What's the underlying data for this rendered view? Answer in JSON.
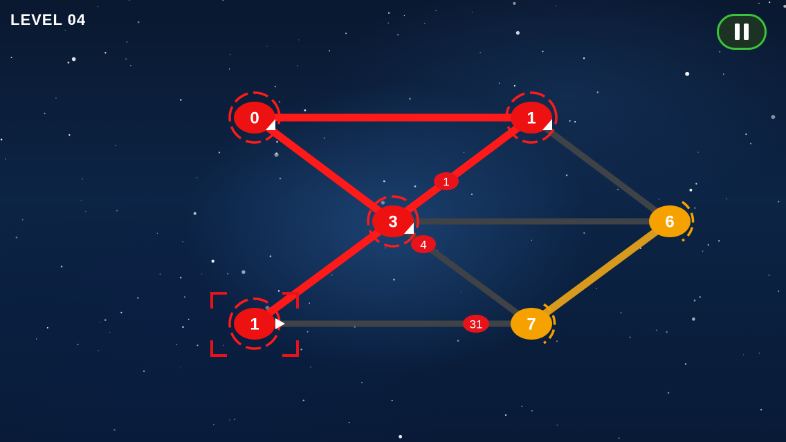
{
  "hud": {
    "level_label": "LEVEL 04",
    "pause_icon": "pause-icon"
  },
  "colors": {
    "active": "#ff1a1a",
    "active_node": "#ee1111",
    "orange": "#f5a100",
    "orange_edge": "#d79a1d",
    "inactive_edge": "#3f4247",
    "pause_border": "#3bc43b"
  },
  "nodes": [
    {
      "id": "n-top-left",
      "label": "0",
      "state": "red",
      "arrow": true
    },
    {
      "id": "n-top-right",
      "label": "1",
      "state": "red",
      "arrow": true
    },
    {
      "id": "n-center",
      "label": "3",
      "state": "red",
      "arrow": true
    },
    {
      "id": "n-right",
      "label": "6",
      "state": "orange",
      "arrow": false
    },
    {
      "id": "n-bottom-left",
      "label": "1",
      "state": "red",
      "arrow": true,
      "selected": true
    },
    {
      "id": "n-bottom-right",
      "label": "7",
      "state": "orange",
      "arrow": false
    }
  ],
  "edges": [
    {
      "from": "n-top-left",
      "to": "n-top-right",
      "state": "red"
    },
    {
      "from": "n-top-left",
      "to": "n-center",
      "state": "red"
    },
    {
      "from": "n-top-right",
      "to": "n-center",
      "state": "red",
      "label": "1"
    },
    {
      "from": "n-center",
      "to": "n-bottom-left",
      "state": "red"
    },
    {
      "from": "n-top-right",
      "to": "n-right",
      "state": "grey"
    },
    {
      "from": "n-center",
      "to": "n-right",
      "state": "grey"
    },
    {
      "from": "n-center",
      "to": "n-bottom-right",
      "state": "grey",
      "label": "4"
    },
    {
      "from": "n-bottom-left",
      "to": "n-bottom-right",
      "state": "grey",
      "label": "31"
    },
    {
      "from": "n-right",
      "to": "n-bottom-right",
      "state": "orange"
    }
  ]
}
